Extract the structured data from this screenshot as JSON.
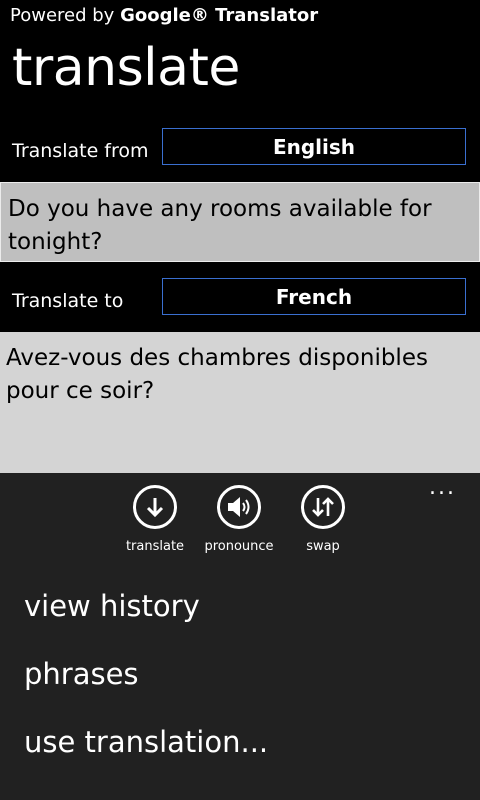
{
  "header": {
    "powered_prefix": "Powered by",
    "powered_brand": "Google® Translator",
    "title": "translate"
  },
  "from": {
    "label": "Translate from",
    "language": "English",
    "text": "Do you have any rooms available for tonight?"
  },
  "to": {
    "label": "Translate to",
    "language": "French",
    "text": "Avez-vous des chambres disponibles pour ce soir?"
  },
  "appbar": {
    "more": "...",
    "buttons": [
      {
        "label": "translate",
        "icon": "arrow-down-circle-icon"
      },
      {
        "label": "pronounce",
        "icon": "speaker-circle-icon"
      },
      {
        "label": "swap",
        "icon": "swap-arrows-circle-icon"
      }
    ],
    "menu": [
      "view history",
      "phrases",
      "use translation..."
    ]
  },
  "colors": {
    "accent_border": "#3a6fd0",
    "source_box": "#bfbfbf",
    "target_box": "#d4d4d4",
    "appbar": "#212121"
  }
}
